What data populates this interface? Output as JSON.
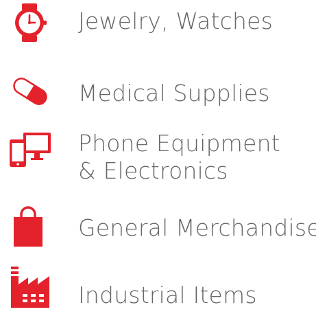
{
  "accent_color": "#e4222b",
  "text_color": "#666666",
  "categories": [
    {
      "icon": "watch-icon",
      "lines": [
        "Jewelry, Watches"
      ]
    },
    {
      "icon": "pill-icon",
      "lines": [
        "Medical Supplies"
      ]
    },
    {
      "icon": "devices-icon",
      "lines": [
        "Phone Equipment",
        "& Electronics"
      ]
    },
    {
      "icon": "shopping-bag-icon",
      "lines": [
        "General Merchandise"
      ]
    },
    {
      "icon": "factory-icon",
      "lines": [
        "Industrial Items"
      ]
    }
  ]
}
